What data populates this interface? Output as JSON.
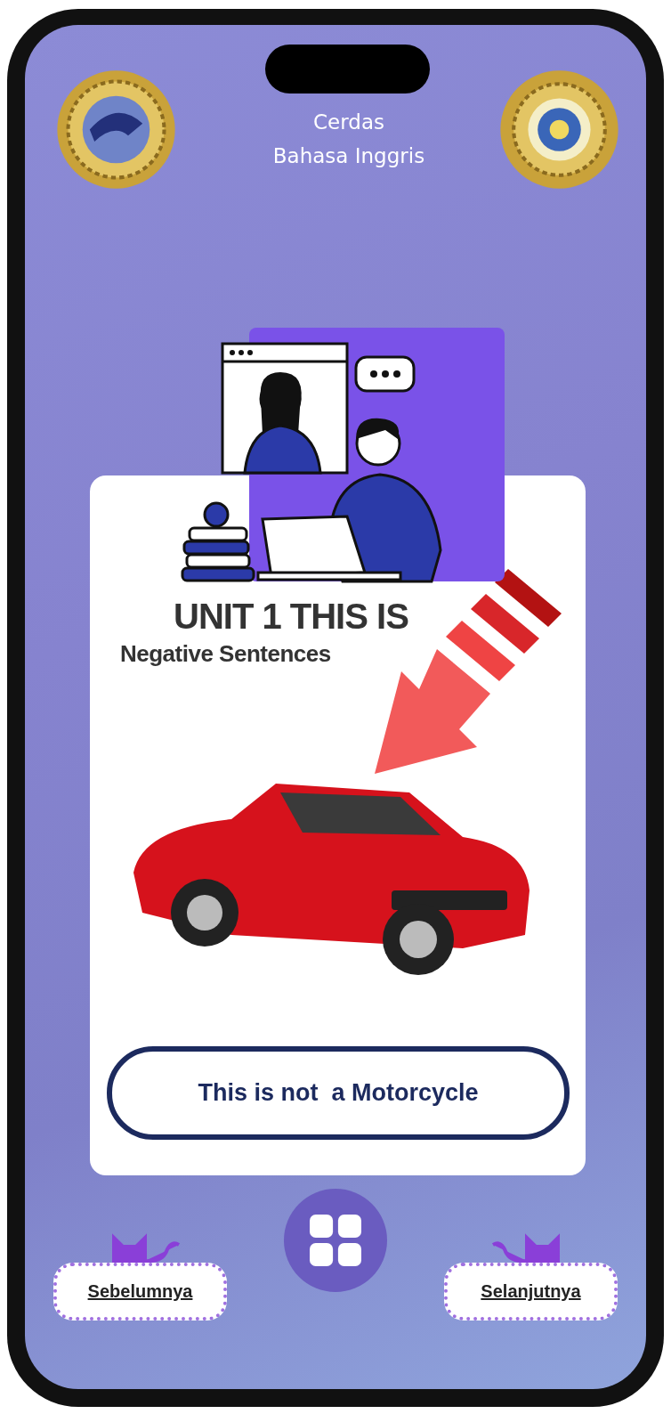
{
  "app": {
    "title_line_1": "Cerdas",
    "title_line_2": "Bahasa Inggris"
  },
  "lesson": {
    "unit_title": "UNIT 1 THIS IS",
    "subtitle": "Negative Sentences",
    "answer": "This is not  a Motorcycle"
  },
  "navigation": {
    "previous": "Sebelumnya",
    "next": "Selanjutnya"
  }
}
